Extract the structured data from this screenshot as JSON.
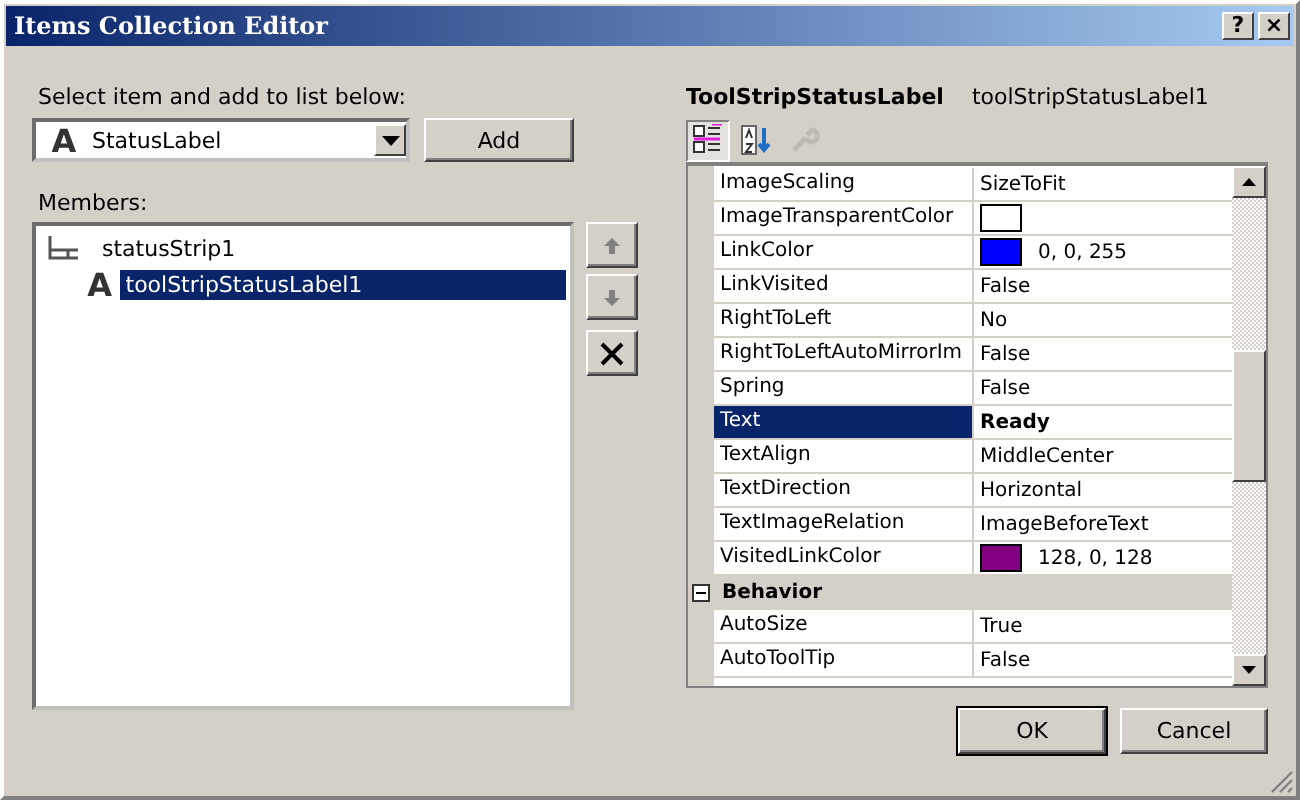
{
  "window": {
    "title": "Items Collection Editor",
    "help": "?",
    "close": "×"
  },
  "select_label": "Select item and add to list below:",
  "item_type": {
    "value": "StatusLabel",
    "icon": "A"
  },
  "add_button": "Add",
  "members_label": "Members:",
  "members": [
    {
      "label": "statusStrip1",
      "selected": false,
      "children": [
        {
          "label": "toolStripStatusLabel1",
          "icon": "A",
          "selected": true
        }
      ]
    }
  ],
  "move_buttons": [
    {
      "kind": "up"
    },
    {
      "kind": "down"
    },
    {
      "kind": "delete"
    }
  ],
  "properties_title": {
    "type": "ToolStripStatusLabel",
    "name": "toolStripStatusLabel1"
  },
  "toolbar": [
    {
      "kind": "categorized",
      "selected": true,
      "disabled": false
    },
    {
      "kind": "alphabetical",
      "selected": false,
      "disabled": false
    },
    {
      "kind": "pages",
      "selected": false,
      "disabled": true
    }
  ],
  "properties": [
    {
      "kind": "property",
      "name": "ImageScaling",
      "value": "SizeToFit",
      "selected": false
    },
    {
      "kind": "property",
      "name": "ImageTransparentColor",
      "color": "#ffffff",
      "selected": false
    },
    {
      "kind": "property",
      "name": "LinkColor",
      "value": "0, 0, 255",
      "color": "#0000ff",
      "selected": false
    },
    {
      "kind": "property",
      "name": "LinkVisited",
      "value": "False",
      "selected": false
    },
    {
      "kind": "property",
      "name": "RightToLeft",
      "value": "No",
      "selected": false
    },
    {
      "kind": "property",
      "name": "RightToLeftAutoMirrorIm",
      "value": "False",
      "selected": false
    },
    {
      "kind": "property",
      "name": "Spring",
      "value": "False",
      "selected": false
    },
    {
      "kind": "property",
      "name": "Text",
      "value": "Ready",
      "selected": true
    },
    {
      "kind": "property",
      "name": "TextAlign",
      "value": "MiddleCenter",
      "selected": false
    },
    {
      "kind": "property",
      "name": "TextDirection",
      "value": "Horizontal",
      "selected": false
    },
    {
      "kind": "property",
      "name": "TextImageRelation",
      "value": "ImageBeforeText",
      "selected": false
    },
    {
      "kind": "property",
      "name": "VisitedLinkColor",
      "value": "128, 0, 128",
      "color": "#800080",
      "selected": false
    },
    {
      "kind": "category",
      "name": "Behavior",
      "expanded": true
    },
    {
      "kind": "property",
      "name": "AutoSize",
      "value": "True",
      "selected": false
    },
    {
      "kind": "property",
      "name": "AutoToolTip",
      "value": "False",
      "selected": false
    }
  ],
  "buttons": [
    {
      "label": "OK",
      "default": true
    },
    {
      "label": "Cancel",
      "default": false
    }
  ]
}
